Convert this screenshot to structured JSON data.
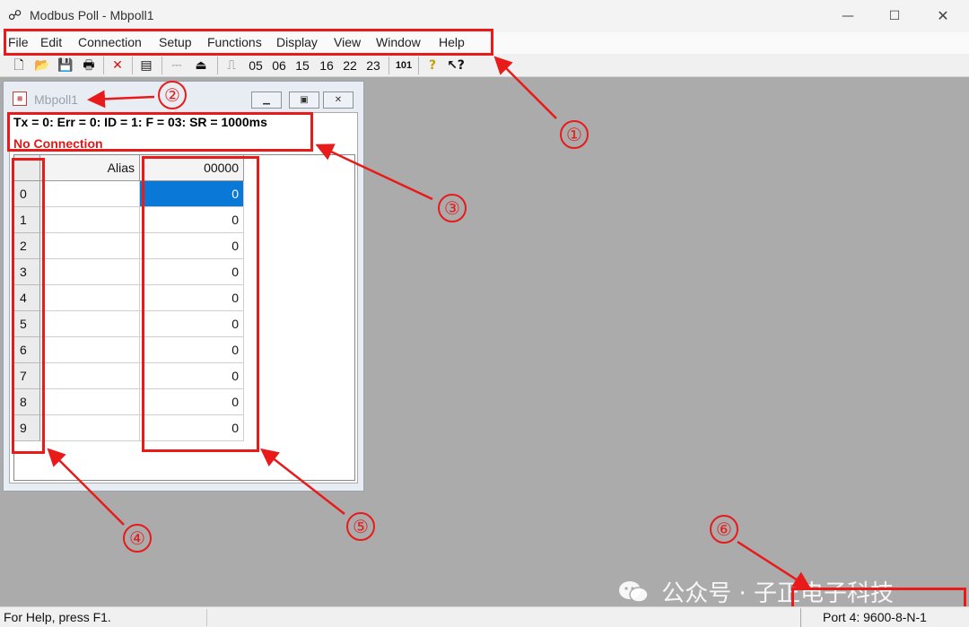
{
  "window": {
    "title": "Modbus Poll - Mbpoll1",
    "minimize": "—",
    "maximize": "☐",
    "close": "✕"
  },
  "menu": [
    "File",
    "Edit",
    "Connection",
    "Setup",
    "Functions",
    "Display",
    "View",
    "Window",
    "Help"
  ],
  "toolbar": {
    "function_codes": [
      "05",
      "06",
      "15",
      "16",
      "22",
      "23"
    ],
    "read_once_label": "101",
    "icons": [
      "new-icon",
      "open-icon",
      "save-icon",
      "print-icon",
      "delete-icon",
      "window-icon",
      "connect-icon",
      "disconnect-icon",
      "pulse-icon",
      "help-icon",
      "context-help-icon"
    ]
  },
  "child": {
    "title": "Mbpoll1",
    "status_line": "Tx = 0: Err = 0: ID = 1: F = 03: SR = 1000ms",
    "connection_status": "No Connection",
    "grid": {
      "alias_header": "Alias",
      "value_header": "00000",
      "rows": [
        {
          "index": "0",
          "alias": "",
          "value": "0"
        },
        {
          "index": "1",
          "alias": "",
          "value": "0"
        },
        {
          "index": "2",
          "alias": "",
          "value": "0"
        },
        {
          "index": "3",
          "alias": "",
          "value": "0"
        },
        {
          "index": "4",
          "alias": "",
          "value": "0"
        },
        {
          "index": "5",
          "alias": "",
          "value": "0"
        },
        {
          "index": "6",
          "alias": "",
          "value": "0"
        },
        {
          "index": "7",
          "alias": "",
          "value": "0"
        },
        {
          "index": "8",
          "alias": "",
          "value": "0"
        },
        {
          "index": "9",
          "alias": "",
          "value": "0"
        }
      ]
    }
  },
  "annotations": {
    "markers": [
      "①",
      "②",
      "③",
      "④",
      "⑤",
      "⑥"
    ],
    "color": "#e81a1a"
  },
  "watermark": "公众号 · 子正电子科技",
  "statusbar": {
    "help": "For Help, press F1.",
    "port": "Port 4: 9600-8-N-1"
  },
  "colors": {
    "mdi_background": "#ababab",
    "selection": "#0a78d7",
    "error_text": "#e01818"
  }
}
